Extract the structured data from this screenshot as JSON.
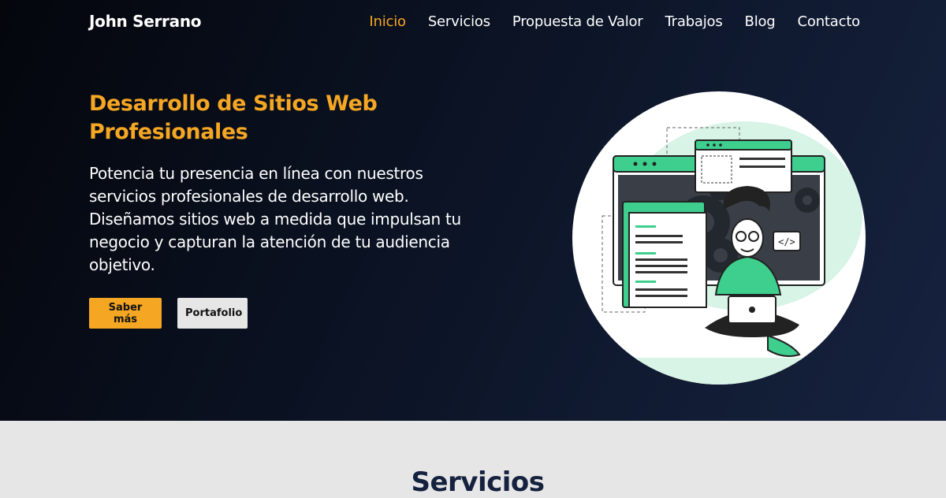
{
  "brand": "John Serrano",
  "nav": [
    "Inicio",
    "Servicios",
    "Propuesta de Valor",
    "Trabajos",
    "Blog",
    "Contacto"
  ],
  "hero": {
    "title": "Desarrollo de Sitios Web Profesionales",
    "text": "Potencia tu presencia en línea con nuestros servicios profesionales de desarrollo web. Diseñamos sitios web a medida que impulsan tu negocio y capturan la atención de tu audiencia objetivo.",
    "primary_button": "Saber más",
    "secondary_button": "Portafolio",
    "code_tag": "</>"
  },
  "services_heading": "Servicios",
  "colors": {
    "accent": "#f5a623",
    "hero_dark": "#0b1324",
    "section_bg": "#e6e6e6",
    "heading": "#15223f",
    "illustration_green": "#3ecf8e"
  }
}
